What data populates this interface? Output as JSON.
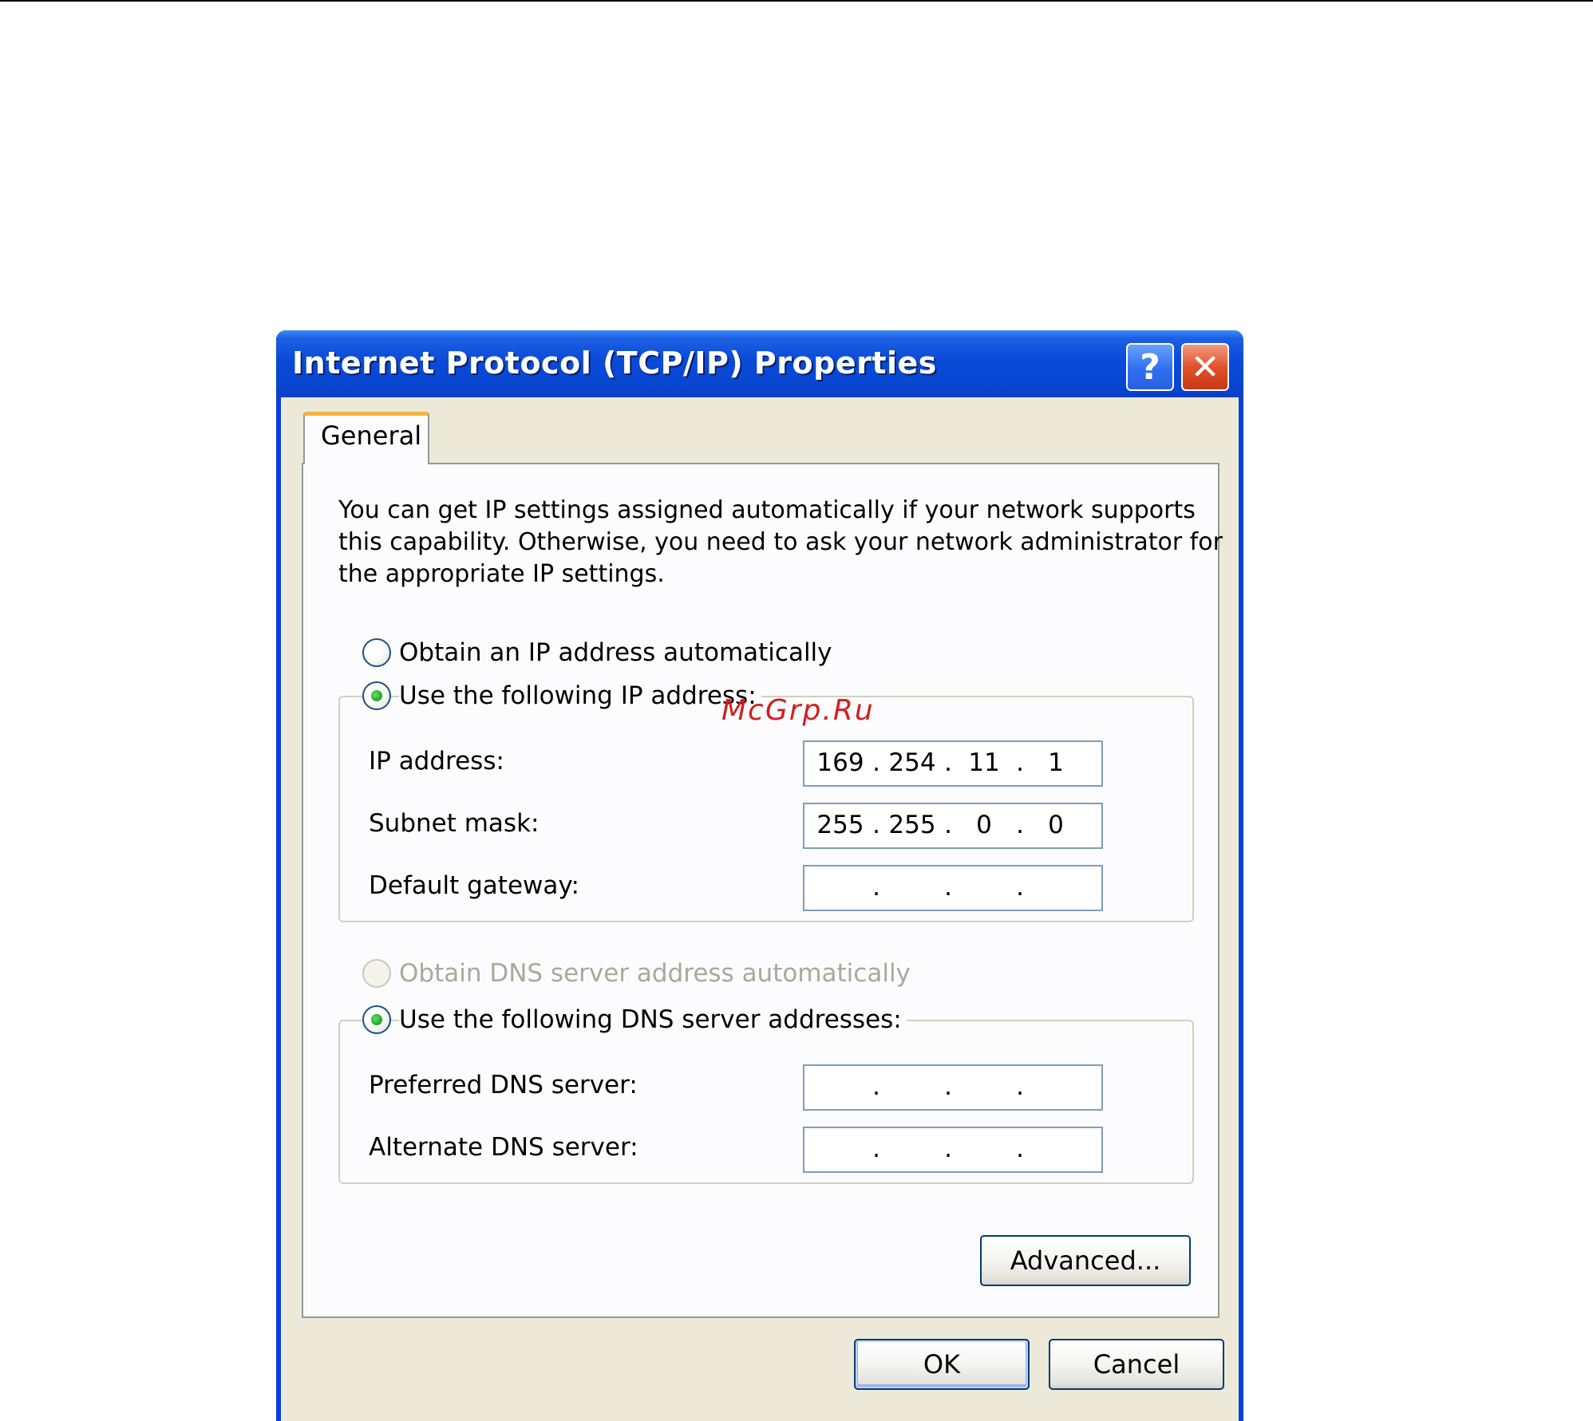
{
  "window": {
    "title": "Internet Protocol (TCP/IP) Properties",
    "help_glyph": "?",
    "close_glyph": "✕"
  },
  "tabs": [
    {
      "label": "General",
      "selected": true
    }
  ],
  "description": {
    "lines": [
      "You can get IP settings assigned automatically if your network supports",
      "this capability. Otherwise, you need to ask your network administrator for",
      "the appropriate IP settings."
    ]
  },
  "ip_options": {
    "auto_label": "Obtain an IP address automatically",
    "auto_checked": false,
    "manual_label": "Use the following IP address:",
    "manual_checked": true
  },
  "ip_fields": [
    {
      "label": "IP address:",
      "octets": [
        "169",
        "254",
        "11",
        "1"
      ]
    },
    {
      "label": "Subnet mask:",
      "octets": [
        "255",
        "255",
        "0",
        "0"
      ]
    },
    {
      "label": "Default gateway:",
      "octets": [
        "",
        "",
        "",
        ""
      ]
    }
  ],
  "dns_options": {
    "auto_label": "Obtain DNS server address automatically",
    "auto_checked": false,
    "auto_disabled": true,
    "manual_label": "Use the following DNS server addresses:",
    "manual_checked": true
  },
  "dns_fields": [
    {
      "label": "Preferred DNS server:",
      "octets": [
        "",
        "",
        "",
        ""
      ]
    },
    {
      "label": "Alternate DNS server:",
      "octets": [
        "",
        "",
        "",
        ""
      ]
    }
  ],
  "separator": ".",
  "buttons": {
    "advanced": "Advanced...",
    "ok": "OK",
    "cancel": "Cancel"
  },
  "watermark": "McGrp.Ru"
}
